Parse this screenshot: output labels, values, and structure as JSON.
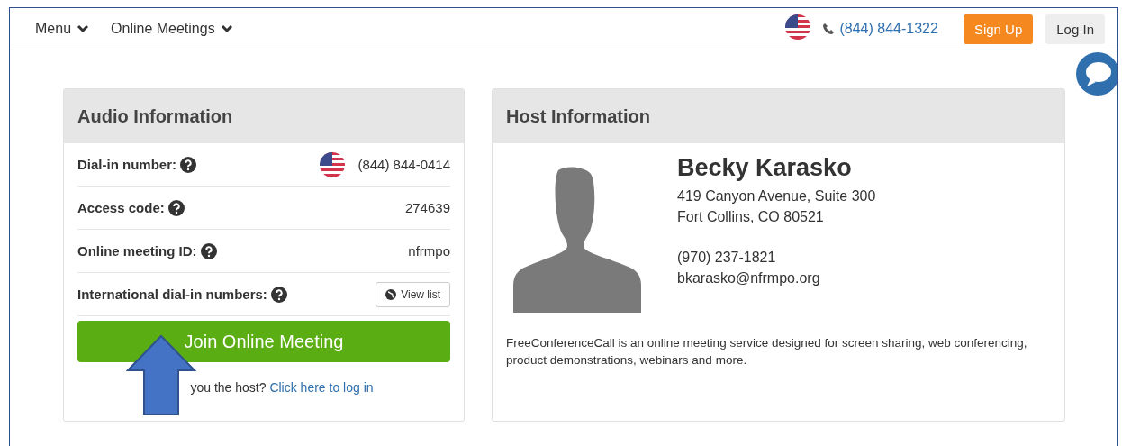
{
  "nav": {
    "menus": [
      {
        "label": "Menu"
      },
      {
        "label": "Online Meetings"
      }
    ],
    "phone": "(844) 844-1322",
    "buttons": [
      {
        "label": "Sign Up",
        "kind": "primary"
      },
      {
        "label": "Log In",
        "kind": "secondary"
      }
    ]
  },
  "audio": {
    "title": "Audio Information",
    "rows": [
      {
        "label": "Dial-in number:",
        "kind": "phone",
        "value": "(844) 844-0414"
      },
      {
        "label": "Access code:",
        "kind": "text",
        "value": "274639"
      },
      {
        "label": "Online meeting ID:",
        "kind": "text",
        "value": "nfrmpo"
      },
      {
        "label": "International dial-in numbers:",
        "kind": "button",
        "value": "View list"
      }
    ],
    "join_button": "Join Online Meeting",
    "host_prompt": "you the host?",
    "login_link": "Click here to log in"
  },
  "host": {
    "title": "Host Information",
    "name": "Becky Karasko",
    "address": [
      "419 Canyon Avenue, Suite 300",
      "Fort Collins, CO 80521"
    ],
    "phone": "(970) 237-1821",
    "email": "bkarasko@nfrmpo.org",
    "description": "FreeConferenceCall is an online meeting service designed for screen sharing, web conferencing, product demonstrations, webinars and more."
  }
}
